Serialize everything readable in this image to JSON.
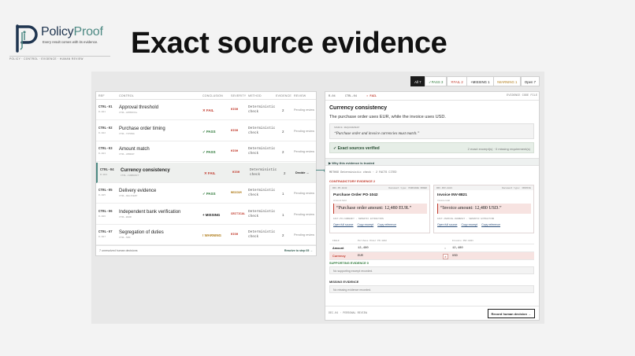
{
  "logo": {
    "brand": "Policy",
    "brand_accent": "Proof",
    "tagline": "Every result comes with its evidence.",
    "sub": "POLICY · CONTROL · EVIDENCE · HUMAN REVIEW"
  },
  "headline": "Exact source evidence",
  "filters": [
    {
      "label": "All 7",
      "active": true
    },
    {
      "label": "✓PASS 3",
      "status": "pass"
    },
    {
      "label": "✕FAIL 2",
      "status": "fail"
    },
    {
      "label": "+MISSING 1",
      "status": "missing"
    },
    {
      "label": "!WARNING 1",
      "status": "warning"
    },
    {
      "label": "Open 7"
    }
  ],
  "table": {
    "headers": [
      "REF",
      "CONTROL",
      "CONCLUSION",
      "SEVERITY",
      "METHOD",
      "EVIDENCE",
      "REVIEW"
    ],
    "rows": [
      {
        "id": "CTRL-01",
        "sub": "R-001",
        "name": "Approval threshold",
        "name_sub": "CTRL-APPROVAL",
        "conclusion": "✕ FAIL",
        "status": "fail",
        "severity": "HIGH",
        "method": "Deterministic check",
        "evidence": "2",
        "review": "Pending review"
      },
      {
        "id": "CTRL-02",
        "sub": "R-002",
        "name": "Purchase order timing",
        "name_sub": "CTRL-TIMING",
        "conclusion": "✓ PASS",
        "status": "pass",
        "severity": "HIGH",
        "method": "Deterministic check",
        "evidence": "2",
        "review": "Pending review"
      },
      {
        "id": "CTRL-03",
        "sub": "R-003",
        "name": "Amount match",
        "name_sub": "CTRL-AMOUNT",
        "conclusion": "✓ PASS",
        "status": "pass",
        "severity": "HIGH",
        "method": "Deterministic check",
        "evidence": "2",
        "review": "Pending review"
      },
      {
        "id": "CTRL-04",
        "sub": "R-004",
        "name": "Currency consistency",
        "name_sub": "CTRL-CURRENCY",
        "conclusion": "✕ FAIL",
        "status": "fail",
        "severity": "HIGH",
        "method": "Deterministic check",
        "evidence": "2",
        "review": "Decide →",
        "selected": true
      },
      {
        "id": "CTRL-05",
        "sub": "R-005",
        "name": "Delivery evidence",
        "name_sub": "CTRL-DELIVERY",
        "conclusion": "✓ PASS",
        "status": "pass",
        "severity": "MEDIUM",
        "method": "Deterministic check",
        "evidence": "1",
        "review": "Pending review"
      },
      {
        "id": "CTRL-06",
        "sub": "R-006",
        "name": "Independent bank verification",
        "name_sub": "CTRL-BANK",
        "conclusion": "+ MISSING",
        "status": "missing",
        "severity": "CRITICAL",
        "method": "Deterministic check",
        "evidence": "1",
        "review": "Pending review"
      },
      {
        "id": "CTRL-07",
        "sub": "R-007",
        "name": "Segregation of duties",
        "name_sub": "CTRL-SOD",
        "conclusion": "! WARNING",
        "status": "warning",
        "severity": "HIGH",
        "method": "Deterministic check",
        "evidence": "2",
        "review": "Pending review"
      }
    ],
    "footer_left": "7 unresolved human decisions",
    "footer_right": "Resolve to step 05 →"
  },
  "detail": {
    "crumb_ref": "R-04",
    "crumb_ctrl": "CTRL-04",
    "crumb_status": "✕ FAIL",
    "crumb_right": "EVIDENCE CODE FILE",
    "title": "Currency consistency",
    "summary": "The purchase order uses EUR, while the invoice uses USD.",
    "req_label": "SOURCE REQUIREMENT",
    "req_text": "“Purchase order and invoice currencies must match.”",
    "verified": "✓ Exact sources verified",
    "verified_sub": "2 exact excerpt(s) · 0 missing requirement(s)",
    "why": "▶ Why this evidence is trusted",
    "method": "METHOD  Deterministic check  ·  2 FACTS CITED",
    "contradictory": "CONTRADICTORY EVIDENCE 2",
    "cards": [
      {
        "ref": "DOC-PO-1042",
        "type": "Document type: PURCHASE ORDER",
        "doc": "Purchase Order PO-1042",
        "field": "Amount field",
        "quote": "“Purchase order amount: 12,480 EUR.”",
        "meta": "FACT-PO-CURRENCY · SEMANTIC EXTRACTION",
        "links": [
          "Open full source",
          "Copy excerpt",
          "Copy reference"
        ]
      },
      {
        "ref": "DOC-INV-8821",
        "type": "Document type: INVOICE",
        "doc": "Invoice INV-8821",
        "field": "Invoice total",
        "quote": "“Invoice amount: 12,480 USD.”",
        "meta": "FACT-INVOICE-CURRENCY · SEMANTIC EXTRACTION",
        "links": [
          "Open full source",
          "Copy excerpt",
          "Copy reference"
        ]
      }
    ],
    "compare": {
      "headers": [
        "FIELD",
        "Purchase Order PO-1042",
        "Invoice INV-8821"
      ],
      "rows": [
        {
          "field": "Amount",
          "a": "12,480",
          "op": "=",
          "b": "12,480"
        },
        {
          "field": "Currency",
          "a": "EUR",
          "op": "≠",
          "b": "USD",
          "bad": true
        }
      ]
    },
    "supporting": "SUPPORTING EVIDENCE 0",
    "supporting_empty": "No supporting excerpt recorded.",
    "missing": "MISSING EVIDENCE",
    "missing_empty": "No missing evidence recorded.",
    "footer_left": "DEC-04  ·  PERSONAL REVIEW",
    "record_button": "Record human decision →"
  },
  "colors": {
    "pass": "#2f7a3b",
    "fail": "#c0392b",
    "warning": "#b07d1b",
    "critical": "#c0392b",
    "accent": "#4e8a84",
    "brand": "#1f3550"
  }
}
